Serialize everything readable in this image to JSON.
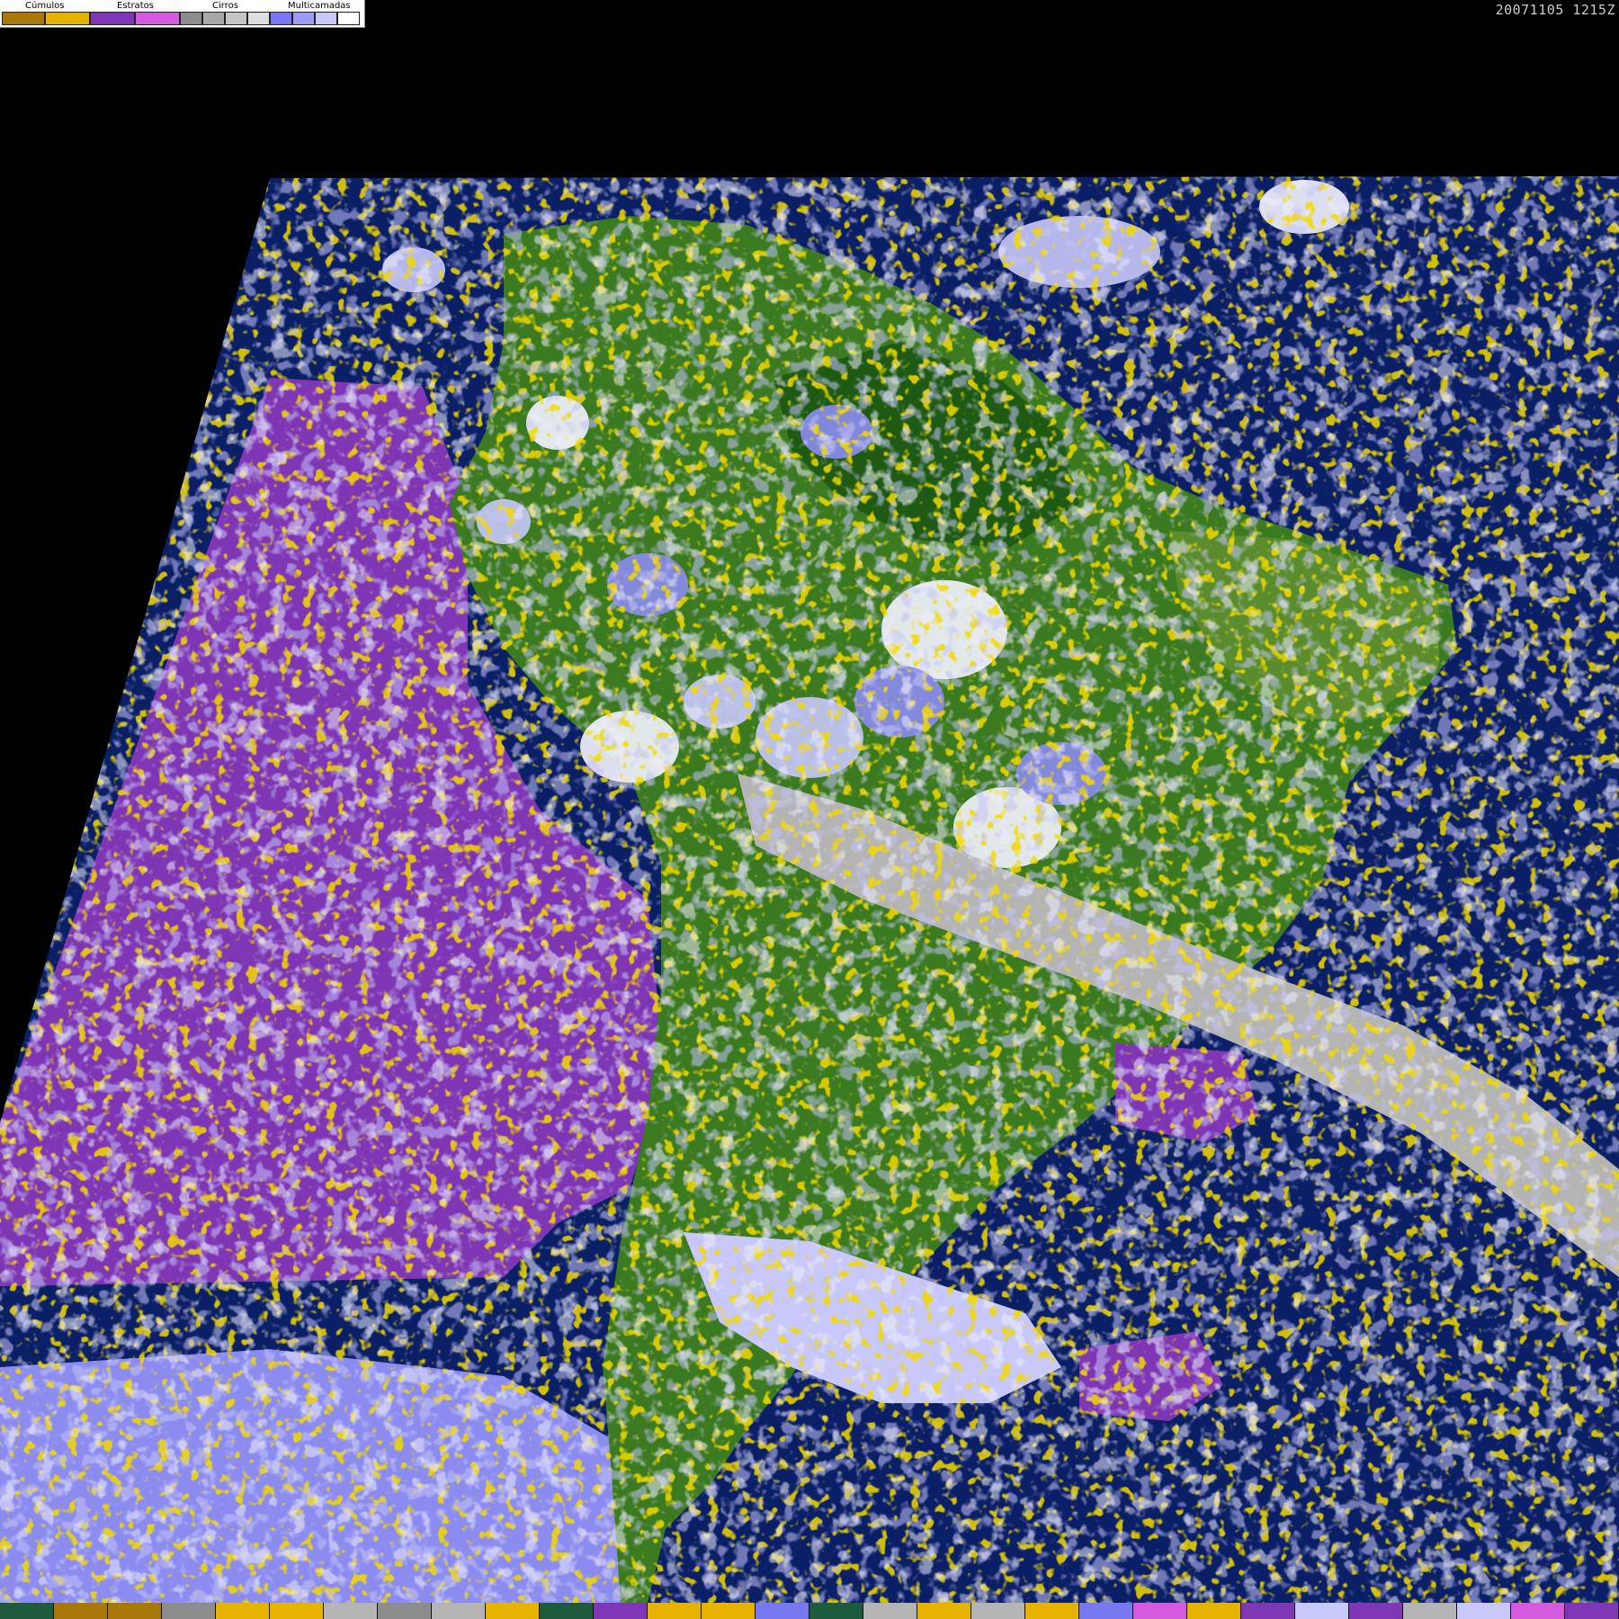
{
  "legend": {
    "labels": [
      "Cúmulos",
      "Estratos",
      "Cirros",
      "Multicamadas"
    ],
    "groups": [
      {
        "name": "cumulos",
        "colors": [
          "#a8780a",
          "#e6b400"
        ]
      },
      {
        "name": "estratos",
        "colors": [
          "#7f36b4",
          "#d45ae0"
        ]
      },
      {
        "name": "cirros",
        "colors": [
          "#8c8c8c",
          "#a8a8a8",
          "#c4c4c4",
          "#dedede"
        ]
      },
      {
        "name": "multicamadas",
        "colors": [
          "#7878f0",
          "#9c9cf4",
          "#c8c8fa",
          "#ffffff"
        ]
      }
    ]
  },
  "timestamp": "20071105 1215Z",
  "palette": {
    "ocean": "#0b1f66",
    "land_dark": "#1e5a14",
    "land": "#3c7a22",
    "land_light": "#5a8c2e",
    "stratus": "#7f36b4",
    "stratus_light": "#d45ae0",
    "cumulus": "#e6b400",
    "cumulus_dark": "#a8780a",
    "cirrus": "#b4b4b4",
    "multi": "#8c8cf0",
    "multi_light": "#c8c8fa",
    "white": "#f4f4ff"
  },
  "bottom_strip": [
    "#1e5a3c",
    "#a8780a",
    "#a8780a",
    "#8c8c8c",
    "#e6b400",
    "#e6b400",
    "#b4b4b4",
    "#8c8c8c",
    "#b4b4b4",
    "#e6b400",
    "#1e5a3c",
    "#7f36b4",
    "#e6b400",
    "#e6b400",
    "#7878f0",
    "#1e5a3c",
    "#b4b4b4",
    "#e6b400",
    "#b4b4b4",
    "#e6b400",
    "#7878f0",
    "#d45ae0",
    "#e6b400",
    "#7f36b4",
    "#c8c8fa",
    "#7f36b4",
    "#b4b4b4",
    "#c8c8fa",
    "#d45ae0",
    "#7f36b4"
  ]
}
